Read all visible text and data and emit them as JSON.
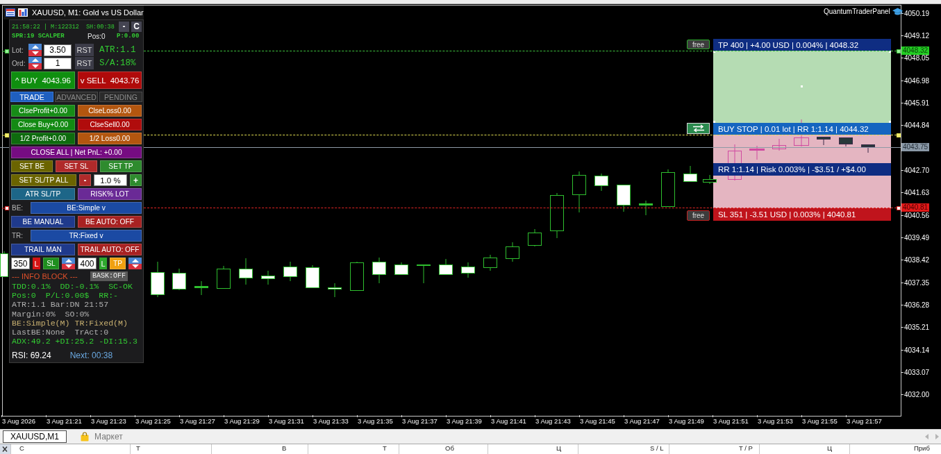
{
  "chart": {
    "title": "XAUUSD, M1: Gold vs US Dollar",
    "indicator": "QuantumTraderPanel",
    "price_axis": [
      "4050.19",
      "4049.12",
      "4048.05",
      "4046.98",
      "4045.91",
      "4044.84",
      "4042.70",
      "4041.63",
      "4040.56",
      "4039.49",
      "4038.42",
      "4037.35",
      "4036.28",
      "4035.21",
      "4034.14",
      "4033.07",
      "4032.00"
    ],
    "time_axis": [
      "3 Aug 2026",
      "3 Aug 21:21",
      "3 Aug 21:23",
      "3 Aug 21:25",
      "3 Aug 21:27",
      "3 Aug 21:29",
      "3 Aug 21:31",
      "3 Aug 21:33",
      "3 Aug 21:35",
      "3 Aug 21:37",
      "3 Aug 21:39",
      "3 Aug 21:41",
      "3 Aug 21:43",
      "3 Aug 21:45",
      "3 Aug 21:47",
      "3 Aug 21:49",
      "3 Aug 21:51",
      "3 Aug 21:53",
      "3 Aug 21:55",
      "3 Aug 21:57"
    ],
    "price_lines": [
      {
        "kind": "take-profit",
        "label": "4048.32"
      },
      {
        "kind": "entry"
      },
      {
        "kind": "bid",
        "label": "4043.75"
      },
      {
        "kind": "stop-loss",
        "label": "4040.81"
      }
    ],
    "trade_box": {
      "take_profit": {
        "button": "free",
        "text": "TP 400 | +4.00 USD | 0.004% | 4048.32"
      },
      "entry": {
        "text": "BUY STOP | 0.01 lot | RR 1:1.14 | 4044.32"
      },
      "summary": "RR 1:1.14 | Risk 0.003% | -$3.51 / +$4.00",
      "stop_loss": {
        "button": "free",
        "text": "SL 351 | -3.51 USD | 0.003% | 4040.81"
      }
    }
  },
  "panel": {
    "clock": "21:58:22 | M:122312",
    "session": "SH:00:38",
    "window_buttons": [
      "-",
      "C"
    ],
    "status": [
      {
        "text": "SPR:19 SCALPER",
        "color": "#33cc33"
      },
      {
        "text": "Pos:0",
        "color": "#e6e6e6"
      },
      {
        "text": "P:0.00",
        "color": "#33cc33"
      }
    ],
    "inputs": [
      {
        "label": "Lot:",
        "value": "3.50",
        "button": "RST",
        "reading": "ATR:1.1"
      },
      {
        "label": "Ord:",
        "value": "1",
        "button": "RST",
        "reading": "S/A:18%"
      }
    ],
    "orders": [
      {
        "kind": "buy",
        "label": "^ BUY  4043.96"
      },
      {
        "kind": "sell",
        "label": "v SELL  4043.76"
      }
    ],
    "tabs": [
      {
        "label": "TRADE",
        "selected": true
      },
      {
        "label": "ADVANCED",
        "selected": false
      },
      {
        "label": "PENDING",
        "selected": false
      }
    ],
    "rows": [
      {
        "items": [
          {
            "kind": "button",
            "label": "ClseProfit+0.00",
            "color": "#178c17"
          },
          {
            "kind": "button",
            "label": "ClseLoss0.00",
            "color": "#b3560f"
          }
        ]
      },
      {
        "items": [
          {
            "kind": "button",
            "label": "Close Buy+0.00",
            "color": "#138a13"
          },
          {
            "kind": "button",
            "label": "ClseSell0.00",
            "color": "#b00c0c"
          }
        ]
      },
      {
        "items": [
          {
            "kind": "button",
            "label": "1/2 Profit+0.00",
            "color": "#0e6b0e"
          },
          {
            "kind": "button",
            "label": "1/2 Loss0.00",
            "color": "#b3560f"
          }
        ]
      },
      {
        "items": [
          {
            "kind": "button",
            "label": "CLOSE ALL | Net PnL: +0.00",
            "color": "#760c82"
          }
        ]
      },
      {
        "items": [
          {
            "kind": "button",
            "label": "SET BE",
            "color": "#6b6400"
          },
          {
            "kind": "button",
            "label": "SET SL",
            "color": "#b02a2a"
          },
          {
            "kind": "button",
            "label": "SET TP",
            "color": "#2e8b2e"
          }
        ]
      },
      {
        "items": [
          {
            "kind": "button",
            "label": "SET SL/TP ALL",
            "color": "#6b6400"
          },
          {
            "kind": "small-button",
            "label": "-",
            "color": "#b02a2a"
          },
          {
            "kind": "field",
            "value": "1.0 %"
          },
          {
            "kind": "small-button",
            "label": "+",
            "color": "#2e8b2e"
          }
        ]
      },
      {
        "items": [
          {
            "kind": "button",
            "label": "ATR SL/TP",
            "color": "#1d6688"
          },
          {
            "kind": "button",
            "label": "RISK% LOT",
            "color": "#6a2a96"
          }
        ]
      },
      {
        "items": [
          {
            "kind": "label",
            "text": "BE:"
          },
          {
            "kind": "dropdown",
            "label": "BE:Simple v",
            "color": "#1b4aa3"
          }
        ]
      },
      {
        "items": [
          {
            "kind": "button",
            "label": "BE MANUAL",
            "color": "#1f3a8c"
          },
          {
            "kind": "button",
            "label": "BE AUTO: OFF",
            "color": "#a82222"
          }
        ]
      },
      {
        "items": [
          {
            "kind": "label",
            "text": "TR:"
          },
          {
            "kind": "dropdown",
            "label": "TR:Fixed v",
            "color": "#1b4aa3"
          }
        ]
      },
      {
        "items": [
          {
            "kind": "button",
            "label": "TRAIL MAN",
            "color": "#1f3a8c"
          },
          {
            "kind": "button",
            "label": "TRAIL AUTO: OFF",
            "color": "#a82222"
          }
        ]
      },
      {
        "items": [
          {
            "kind": "short-field",
            "value": "350"
          },
          {
            "kind": "toggle",
            "label": "L",
            "color": "#d41414"
          },
          {
            "kind": "button",
            "label": "SL",
            "color": "#1e8e1e"
          },
          {
            "kind": "spinner"
          },
          {
            "kind": "short-field",
            "value": "400"
          },
          {
            "kind": "toggle",
            "label": "L",
            "color": "#2ea82e"
          },
          {
            "kind": "button",
            "label": "TP",
            "color": "#f0a010"
          },
          {
            "kind": "spinner"
          }
        ]
      }
    ],
    "info_title": "--- INFO BLOCK ---",
    "basket_button": "BASK:OFF",
    "info_lines": [
      {
        "text": "TDD:0.1%  DD:-0.1%  SC-OK",
        "color": "#33cc33"
      },
      {
        "text": "Pos:0  P/L:0.00$  RR:-",
        "color": "#33cc33"
      },
      {
        "text": "ATR:1.1 Bar:DN 21:57",
        "color": "#b0b0b0"
      },
      {
        "text": "Margin:0%  SO:0%",
        "color": "#b0b0b0"
      },
      {
        "text": "BE:Simple(M) TR:Fixed(M)",
        "color": "#c8b070"
      },
      {
        "text": "LastBE:None  TrAct:0",
        "color": "#b0b0b0"
      },
      {
        "text": "ADX:49.2 +DI:25.2 -DI:15.3",
        "color": "#33cc33"
      }
    ],
    "rsi": "RSI: 69.24",
    "next": "Next: 00:38"
  },
  "bottom": {
    "tabs": [
      {
        "kind": "chart",
        "label": "XAUUSD,M1",
        "selected": true
      },
      {
        "kind": "market",
        "label": "Маркет",
        "selected": false
      }
    ],
    "columns": [
      "С",
      "Т",
      "В",
      "Т",
      "Об",
      "Ц",
      "S / L",
      "T / P",
      "Ц",
      "Приб"
    ]
  }
}
